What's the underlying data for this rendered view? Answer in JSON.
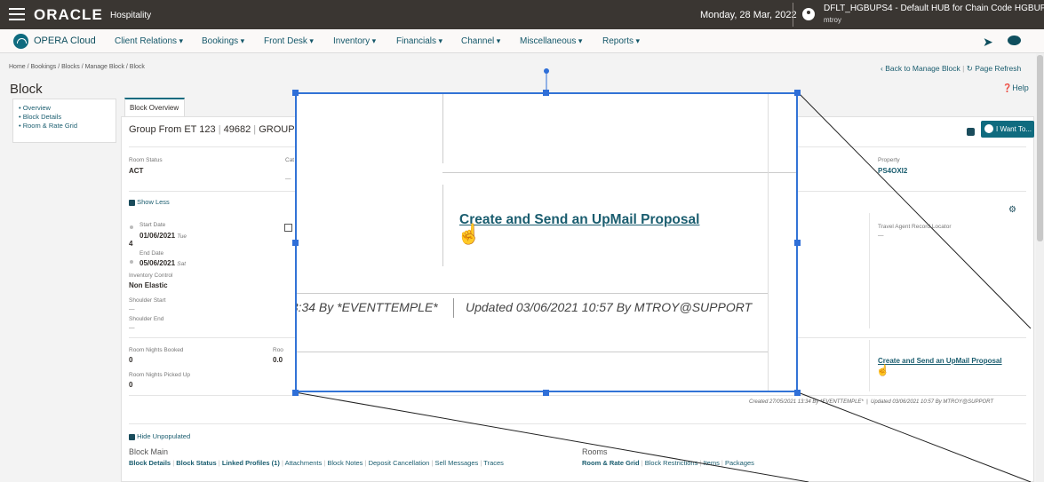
{
  "topbar": {
    "logo": "ORACLE",
    "logo_sub": "Hospitality",
    "date": "Monday, 28 Mar, 2022",
    "user_line1": "DFLT_HGBUPS4 - Default HUB for Chain Code HGBUPS4",
    "user_line2": "mtroy"
  },
  "nav": {
    "app": "OPERA Cloud",
    "menus": [
      "Client Relations",
      "Bookings",
      "Front Desk",
      "Inventory",
      "Financials",
      "Channel",
      "Miscellaneous",
      "Reports"
    ]
  },
  "breadcrumb": "Home / Bookings / Blocks / Manage Block / Block",
  "back_link": "Back to Manage Block",
  "refresh_link": "Page Refresh",
  "page_title": "Block",
  "help": "Help",
  "sidenav": [
    "Overview",
    "Block Details",
    "Room & Rate Grid"
  ],
  "tab": "Block Overview",
  "header": {
    "group_name": "Group From ET 123",
    "block_id": "49682",
    "group_code": "GROUP"
  },
  "want_to": "I Want To...",
  "fields": {
    "room_status_label": "Room Status",
    "room_status": "ACT",
    "cat_label": "Cat",
    "property_label": "Property",
    "property": "PS4OXI2",
    "show_less": "Show Less",
    "start_date_label": "Start Date",
    "start_date": "01/06/2021",
    "start_day": "Tue",
    "nights": "4",
    "end_date_label": "End Date",
    "end_date": "05/06/2021",
    "end_day": "Sat",
    "inv_control_label": "Inventory Control",
    "inv_control": "Non Elastic",
    "shoulder_start_label": "Shoulder Start",
    "shoulder_end_label": "Shoulder End",
    "dash": "—",
    "travel_agent_label": "Travel Agent Record Locator",
    "room_nights_booked_label": "Room Nights Booked",
    "room_nights_booked": "0",
    "room_nights_picked_label": "Room Nights Picked Up",
    "room_nights_picked": "0",
    "ro_label": "Roo",
    "ro_val": "0.0",
    "upmail_link": "Create and Send an UpMail Proposal",
    "created": "Created 27/05/2021 13:34 By *EVENTTEMPLE*",
    "updated": "Updated 03/06/2021 10:57 By MTROY@SUPPORT",
    "hide_unpopulated": "Hide Unpopulated"
  },
  "block_main": {
    "label": "Block Main",
    "links": [
      "Block Details",
      "Block Status",
      "Linked Profiles (1)",
      "Attachments",
      "Block Notes",
      "Deposit Cancellation",
      "Sell Messages",
      "Traces"
    ]
  },
  "rooms": {
    "label": "Rooms",
    "links": [
      "Room & Rate Grid",
      "Block Restrictions",
      "Items",
      "Packages"
    ]
  },
  "zoom": {
    "link": "Create and Send an UpMail Proposal",
    "created_partial": "13:34 By *EVENTTEMPLE*",
    "updated": "Updated 03/06/2021 10:57 By MTROY@SUPPORT"
  }
}
